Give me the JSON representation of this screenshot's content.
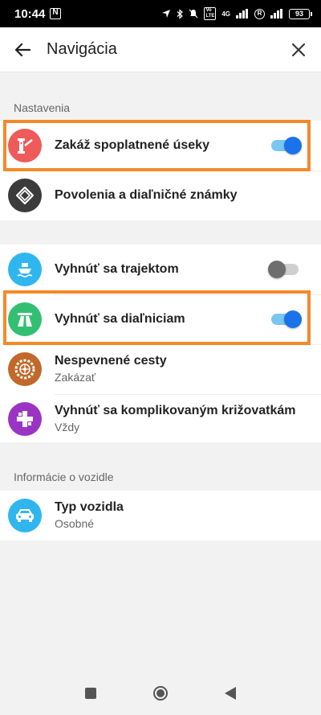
{
  "status_bar": {
    "time": "10:44",
    "network": "4G",
    "battery": "93"
  },
  "header": {
    "title": "Navigácia"
  },
  "sections": {
    "settings": {
      "label": "Nastavenia"
    },
    "vehicle": {
      "label": "Informácie o vozidle"
    }
  },
  "items": {
    "tolls": {
      "title": "Zakáž spoplatnené úseky",
      "toggle": true
    },
    "permits": {
      "title": "Povolenia a diaľničné známky"
    },
    "ferries": {
      "title": "Vyhnúť sa trajektom",
      "toggle": false
    },
    "highways": {
      "title": "Vyhnúť sa diaľniciam",
      "toggle": true
    },
    "unpaved": {
      "title": "Nespevnené cesty",
      "subtitle": "Zakázať"
    },
    "intersections": {
      "title": "Vyhnúť sa komplikovaným križovatkám",
      "subtitle": "Vždy"
    },
    "vehicle_type": {
      "title": "Typ vozidla",
      "subtitle": "Osobné"
    }
  },
  "colors": {
    "toll_icon": "#ef5b5b",
    "permit_icon": "#3b3b3b",
    "ferry_icon": "#2fb6ee",
    "highway_icon": "#33bf72",
    "unpaved_icon": "#c0692b",
    "intersection_icon": "#9b34c4",
    "vehicle_icon": "#2fb6ee",
    "highlight": "#f38a2a",
    "toggle_on": "#1a73e8"
  }
}
